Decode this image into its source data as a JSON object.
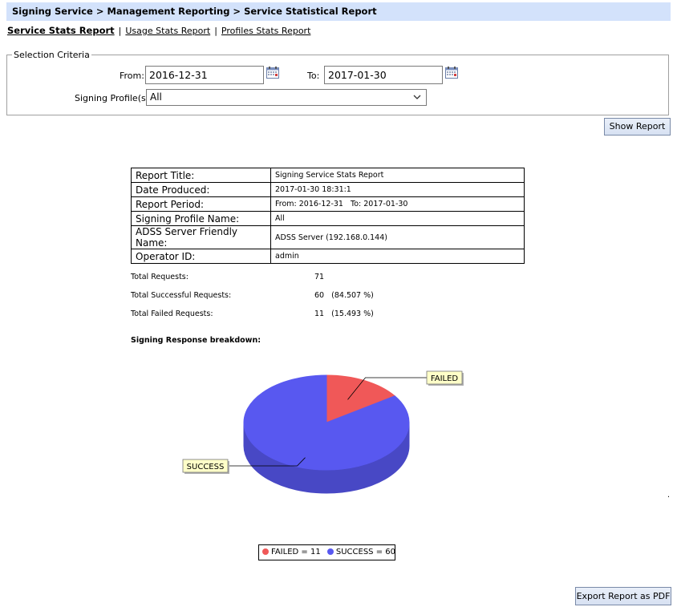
{
  "header": {
    "breadcrumb": "Signing Service > Management Reporting > Service Statistical Report"
  },
  "tabs": [
    {
      "label": "Service Stats Report"
    },
    {
      "label": "Usage Stats Report"
    },
    {
      "label": "Profiles Stats Report"
    }
  ],
  "tab_separator": "|",
  "criteria": {
    "legend": "Selection Criteria",
    "from_label": "From:",
    "from_value": "2016-12-31",
    "to_label": "To:",
    "to_value": "2017-01-30",
    "profile_label": "Signing Profile(s):",
    "profile_value": "All"
  },
  "buttons": {
    "show_report": "Show Report",
    "export_pdf": "Export Report as PDF"
  },
  "report_info": [
    {
      "key": "Report Title:",
      "value": "Signing Service Stats Report"
    },
    {
      "key": "Date Produced:",
      "value": "2017-01-30 18:31:1"
    },
    {
      "key": "Report Period:",
      "value": "From: 2016-12-31   To: 2017-01-30"
    },
    {
      "key": "Signing Profile Name:",
      "value": "All"
    },
    {
      "key": "ADSS Server Friendly Name:",
      "value": "ADSS Server (192.168.0.144)"
    },
    {
      "key": "Operator ID:",
      "value": "admin"
    }
  ],
  "stats": [
    {
      "label": "Total Requests:",
      "value": "71"
    },
    {
      "label": "Total Successful Requests:",
      "value": "60   (84.507 %)"
    },
    {
      "label": "Total Failed Requests:",
      "value": "11   (15.493 %)"
    }
  ],
  "chart_heading": "Signing Response breakdown:",
  "chart_data": {
    "type": "pie",
    "slices": [
      {
        "label": "FAILED",
        "value": 11,
        "color": "#f05858"
      },
      {
        "label": "SUCCESS",
        "value": 60,
        "color": "#5858f0"
      }
    ],
    "legend": [
      "FAILED = 11",
      "SUCCESS = 60"
    ],
    "legend_placement": "bottom"
  },
  "footer_mark": "."
}
